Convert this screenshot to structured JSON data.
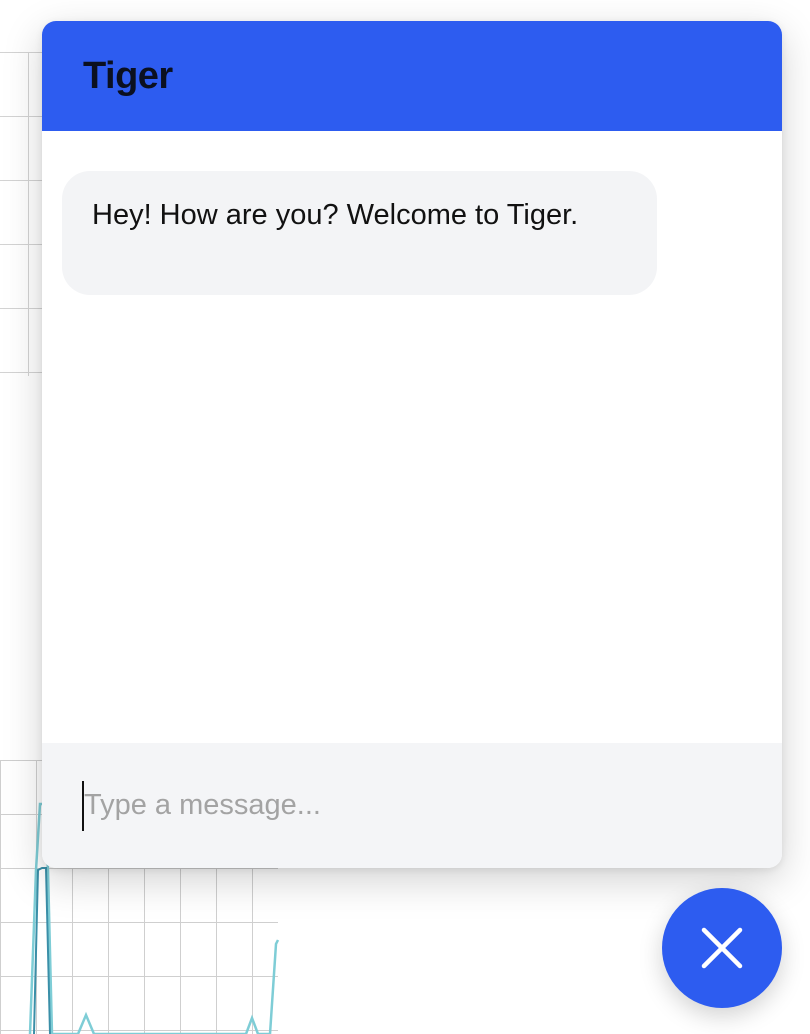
{
  "chat": {
    "title": "Tiger",
    "messages": [
      {
        "sender": "bot",
        "text": "Hey! How are you? Welcome to Tiger."
      }
    ],
    "input": {
      "value": "",
      "placeholder": "Type a message..."
    },
    "launcher": {
      "icon": "close-icon",
      "state": "open"
    }
  },
  "colors": {
    "accent": "#2d5cf0",
    "header_text": "#0b1020",
    "bubble_bg": "#f3f4f6",
    "input_bar_bg": "#f4f5f7",
    "placeholder": "#a3a3a3",
    "chart_line": "#7ecdd6",
    "chart_line_dark": "#3a8fa8"
  }
}
